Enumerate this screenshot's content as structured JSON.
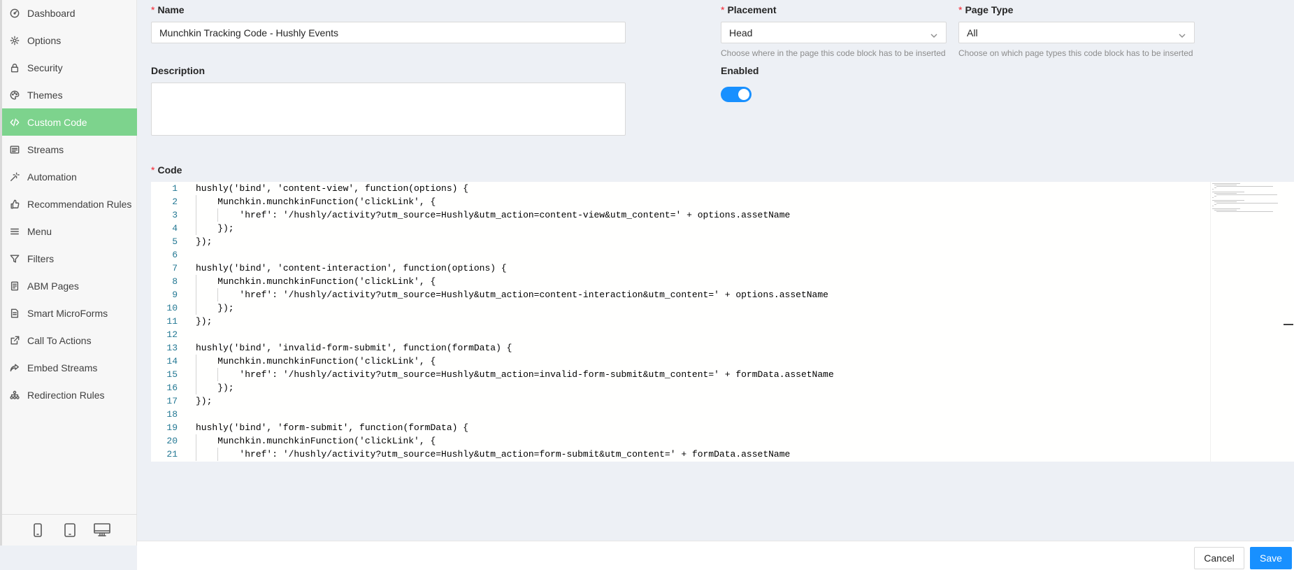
{
  "sidebar": {
    "items": [
      {
        "label": "Dashboard",
        "icon": "dashboard-icon"
      },
      {
        "label": "Options",
        "icon": "gear-icon"
      },
      {
        "label": "Security",
        "icon": "lock-icon"
      },
      {
        "label": "Themes",
        "icon": "palette-icon"
      },
      {
        "label": "Custom Code",
        "icon": "code-icon",
        "active": true
      },
      {
        "label": "Streams",
        "icon": "streams-icon"
      },
      {
        "label": "Automation",
        "icon": "magic-wand-icon"
      },
      {
        "label": "Recommendation Rules",
        "icon": "thumbs-up-icon"
      },
      {
        "label": "Menu",
        "icon": "menu-icon"
      },
      {
        "label": "Filters",
        "icon": "filter-icon"
      },
      {
        "label": "ABM Pages",
        "icon": "book-icon"
      },
      {
        "label": "Smart MicroForms",
        "icon": "form-icon"
      },
      {
        "label": "Call To Actions",
        "icon": "external-link-icon"
      },
      {
        "label": "Embed Streams",
        "icon": "share-icon"
      },
      {
        "label": "Redirection Rules",
        "icon": "cluster-icon"
      }
    ],
    "devices": [
      "mobile-icon",
      "tablet-icon",
      "desktop-icon"
    ]
  },
  "form": {
    "name_label": "Name",
    "name_value": "Munchkin Tracking Code - Hushly Events",
    "description_label": "Description",
    "description_value": "",
    "placement_label": "Placement",
    "placement_value": "Head",
    "placement_help": "Choose where in the page this code block has to be inserted",
    "page_type_label": "Page Type",
    "page_type_value": "All",
    "page_type_help": "Choose on which page types this code block has to be inserted",
    "enabled_label": "Enabled",
    "enabled_value": true,
    "code_label": "Code",
    "required_mark": "*"
  },
  "code": {
    "lines": [
      "hushly('bind', 'content-view', function(options) {",
      "    Munchkin.munchkinFunction('clickLink', {",
      "        'href': '/hushly/activity?utm_source=Hushly&utm_action=content-view&utm_content=' + options.assetName",
      "    });",
      "});",
      "",
      "hushly('bind', 'content-interaction', function(options) {",
      "    Munchkin.munchkinFunction('clickLink', {",
      "        'href': '/hushly/activity?utm_source=Hushly&utm_action=content-interaction&utm_content=' + options.assetName",
      "    });",
      "});",
      "",
      "hushly('bind', 'invalid-form-submit', function(formData) {",
      "    Munchkin.munchkinFunction('clickLink', {",
      "        'href': '/hushly/activity?utm_source=Hushly&utm_action=invalid-form-submit&utm_content=' + formData.assetName",
      "    });",
      "});",
      "",
      "hushly('bind', 'form-submit', function(formData) {",
      "    Munchkin.munchkinFunction('clickLink', {",
      "        'href': '/hushly/activity?utm_source=Hushly&utm_action=form-submit&utm_content=' + formData.assetName"
    ]
  },
  "footer": {
    "cancel_label": "Cancel",
    "save_label": "Save"
  },
  "colors": {
    "accent": "#1890ff",
    "active_sidebar": "#7dd38d",
    "required": "#f5222d",
    "line_number": "#237893"
  }
}
